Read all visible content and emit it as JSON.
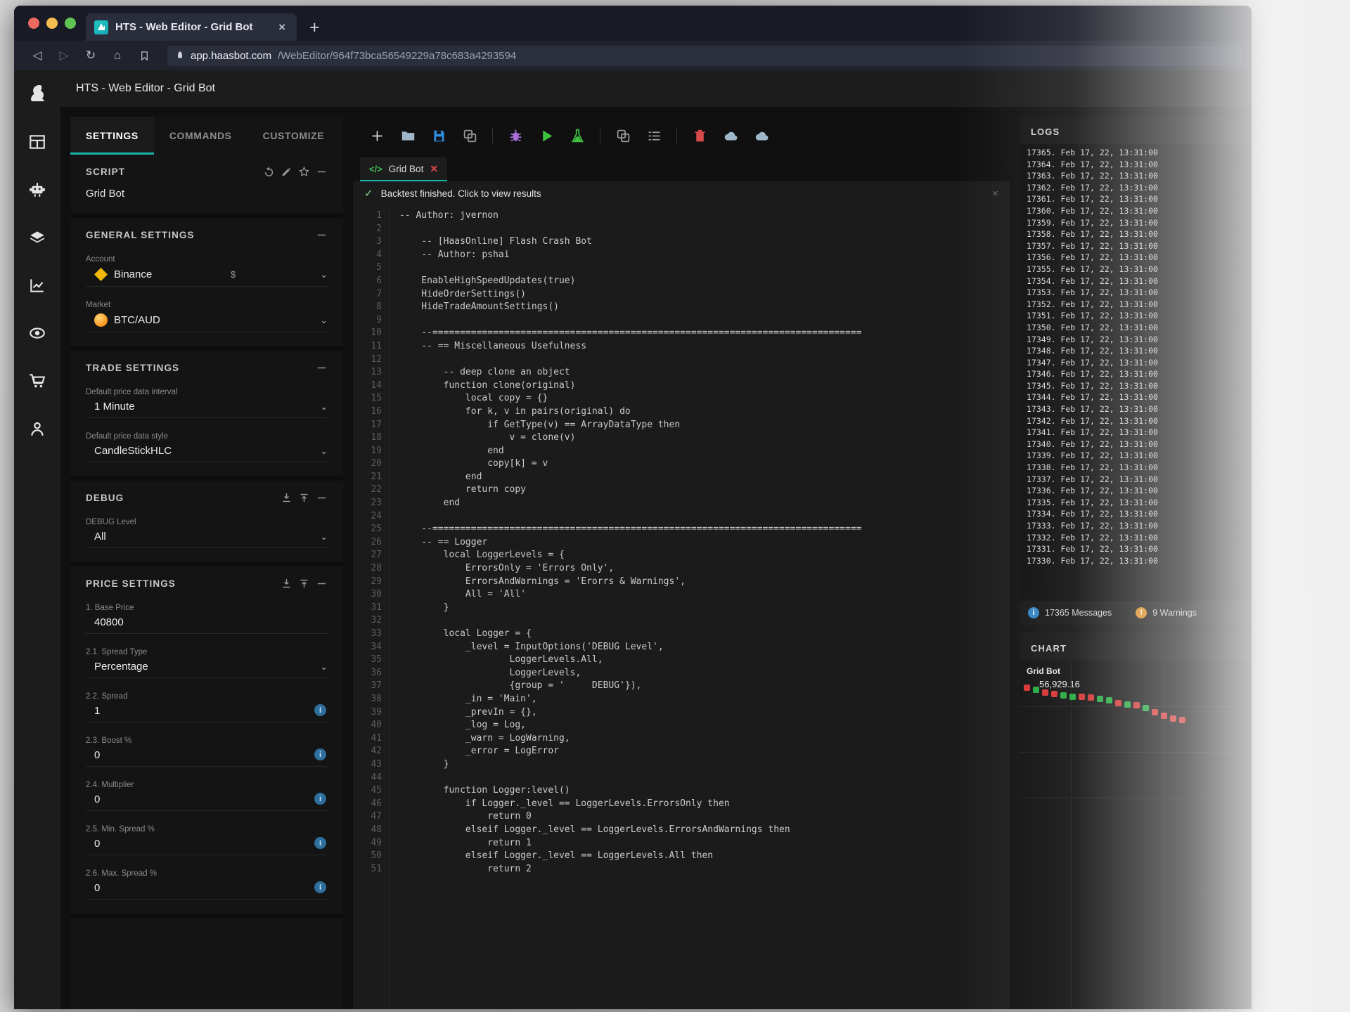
{
  "browser": {
    "tab_title": "HTS - Web Editor - Grid Bot",
    "tab_close": "×",
    "new_tab": "+",
    "favicon_glyph": "◤",
    "back": "◁",
    "forward": "▷",
    "reload": "↻",
    "home": "⌂",
    "bookmark": "☐",
    "lock": "🔒",
    "url_host": "app.haasbot.com",
    "url_path": "/WebEditor/964f73bca56549229a78c683a4293594"
  },
  "app": {
    "title": "HTS - Web Editor - Grid Bot",
    "accent": "#16b6a8",
    "rail": [
      {
        "name": "logo-rabbit"
      },
      {
        "name": "dashboard-grid"
      },
      {
        "name": "bot"
      },
      {
        "name": "layers"
      },
      {
        "name": "chart"
      },
      {
        "name": "coin"
      },
      {
        "name": "cart"
      },
      {
        "name": "account"
      }
    ]
  },
  "settings_panel": {
    "tabs": [
      {
        "label": "SETTINGS",
        "active": true
      },
      {
        "label": "COMMANDS",
        "active": false
      },
      {
        "label": "CUSTOMIZE",
        "active": false
      }
    ],
    "script": {
      "heading": "SCRIPT",
      "name": "Grid Bot",
      "actions": [
        "revert-icon",
        "edit-icon",
        "star-icon",
        "collapse-icon"
      ]
    },
    "general": {
      "heading": "GENERAL SETTINGS",
      "fields": [
        {
          "label": "Account",
          "value": "Binance",
          "icon": "bnb",
          "suffix": "$",
          "caret": true
        },
        {
          "label": "Market",
          "value": "BTC/AUD",
          "icon": "btc",
          "suffix": "",
          "caret": true
        }
      ]
    },
    "trade": {
      "heading": "TRADE SETTINGS",
      "fields": [
        {
          "label": "Default price data interval",
          "value": "1 Minute",
          "caret": true
        },
        {
          "label": "Default price data style",
          "value": "CandleStickHLC",
          "caret": true
        }
      ]
    },
    "debug": {
      "heading": "DEBUG",
      "fields": [
        {
          "label": "DEBUG Level",
          "value": "All",
          "caret": true
        }
      ]
    },
    "price": {
      "heading": "PRICE SETTINGS",
      "fields": [
        {
          "label": "1. Base Price",
          "value": "40800",
          "info": false
        },
        {
          "label": "2.1. Spread Type",
          "value": "Percentage",
          "caret": true
        },
        {
          "label": "2.2. Spread",
          "value": "1",
          "info": true
        },
        {
          "label": "2.3. Boost %",
          "value": "0",
          "info": true
        },
        {
          "label": "2.4. Multiplier",
          "value": "0",
          "info": true
        },
        {
          "label": "2.5. Min. Spread %",
          "value": "0",
          "info": true
        },
        {
          "label": "2.6. Max. Spread %",
          "value": "0",
          "info": true
        }
      ]
    }
  },
  "editor": {
    "toolbar": [
      {
        "name": "new-icon",
        "glyph": "plus",
        "color": "#d6d6d6"
      },
      {
        "name": "open-folder-icon",
        "glyph": "folder",
        "color": "#9fb8c9"
      },
      {
        "name": "save-icon",
        "glyph": "save",
        "color": "#2f8fe0"
      },
      {
        "name": "clone-icon",
        "glyph": "copy",
        "color": "#9a9a9a"
      },
      {
        "name": "sep1",
        "glyph": "sep",
        "color": ""
      },
      {
        "name": "debug-icon",
        "glyph": "bug",
        "color": "#a96fd6"
      },
      {
        "name": "run-icon",
        "glyph": "play",
        "color": "#3fbf42"
      },
      {
        "name": "backtest-icon",
        "glyph": "flask",
        "color": "#3fbf42"
      },
      {
        "name": "sep2",
        "glyph": "sep",
        "color": ""
      },
      {
        "name": "duplicate-icon",
        "glyph": "copy",
        "color": "#9a9a9a"
      },
      {
        "name": "list-icon",
        "glyph": "list",
        "color": "#9a9a9a"
      },
      {
        "name": "sep3",
        "glyph": "sep",
        "color": ""
      },
      {
        "name": "delete-icon",
        "glyph": "trash",
        "color": "#d94b4b"
      },
      {
        "name": "cloud-download-icon",
        "glyph": "cloud",
        "color": "#9fb8c9"
      },
      {
        "name": "cloud-upload-icon",
        "glyph": "cloud",
        "color": "#9fb8c9"
      }
    ],
    "tab": {
      "label": "Grid Bot",
      "code_glyph": "</>",
      "close": "✕"
    },
    "status": {
      "icon": "✓",
      "text": "Backtest finished. Click to view results",
      "close": "×"
    },
    "code": [
      {
        "n": 1,
        "t": "-- Author: jvernon",
        "c": "cmt"
      },
      {
        "n": 2,
        "t": "",
        "c": ""
      },
      {
        "n": 3,
        "t": "    -- [HaasOnline] Flash Crash Bot",
        "c": "cmt"
      },
      {
        "n": 4,
        "t": "    -- Author: pshai",
        "c": "cmt"
      },
      {
        "n": 5,
        "t": "",
        "c": ""
      },
      {
        "n": 6,
        "t": "    EnableHighSpeedUpdates(true)",
        "c": "fn"
      },
      {
        "n": 7,
        "t": "    HideOrderSettings()",
        "c": "fn"
      },
      {
        "n": 8,
        "t": "    HideTradeAmountSettings()",
        "c": "fn"
      },
      {
        "n": 9,
        "t": "",
        "c": ""
      },
      {
        "n": 10,
        "t": "    --==============================================================================",
        "c": "cmt"
      },
      {
        "n": 11,
        "t": "    -- == Miscellaneous Usefulness",
        "c": "cmt"
      },
      {
        "n": 12,
        "t": "",
        "c": ""
      },
      {
        "n": 13,
        "t": "        -- deep clone an object",
        "c": "cmt"
      },
      {
        "n": 14,
        "t": "        function clone(original)",
        "c": "kw"
      },
      {
        "n": 15,
        "t": "            local copy = {}",
        "c": "kw"
      },
      {
        "n": 16,
        "t": "            for k, v in pairs(original) do",
        "c": "kw"
      },
      {
        "n": 17,
        "t": "                if GetType(v) == ArrayDataType then",
        "c": "kw"
      },
      {
        "n": 18,
        "t": "                    v = clone(v)",
        "c": "idf"
      },
      {
        "n": 19,
        "t": "                end",
        "c": "kw"
      },
      {
        "n": 20,
        "t": "                copy[k] = v",
        "c": "idf"
      },
      {
        "n": 21,
        "t": "            end",
        "c": "kw"
      },
      {
        "n": 22,
        "t": "            return copy",
        "c": "kw"
      },
      {
        "n": 23,
        "t": "        end",
        "c": "kw"
      },
      {
        "n": 24,
        "t": "",
        "c": ""
      },
      {
        "n": 25,
        "t": "    --==============================================================================",
        "c": "cmt"
      },
      {
        "n": 26,
        "t": "    -- == Logger",
        "c": "cmt"
      },
      {
        "n": 27,
        "t": "        local LoggerLevels = {",
        "c": "kw"
      },
      {
        "n": 28,
        "t": "            ErrorsOnly = 'Errors Only',",
        "c": "str"
      },
      {
        "n": 29,
        "t": "            ErrorsAndWarnings = 'Erorrs & Warnings',",
        "c": "str"
      },
      {
        "n": 30,
        "t": "            All = 'All'",
        "c": "str"
      },
      {
        "n": 31,
        "t": "        }",
        "c": "idf"
      },
      {
        "n": 32,
        "t": "",
        "c": ""
      },
      {
        "n": 33,
        "t": "        local Logger = {",
        "c": "kw"
      },
      {
        "n": 34,
        "t": "            _level = InputOptions('DEBUG Level',",
        "c": "fn"
      },
      {
        "n": 35,
        "t": "                    LoggerLevels.All,",
        "c": "idf"
      },
      {
        "n": 36,
        "t": "                    LoggerLevels,",
        "c": "idf"
      },
      {
        "n": 37,
        "t": "                    {group = '     DEBUG'}),",
        "c": "str"
      },
      {
        "n": 38,
        "t": "            _in = 'Main',",
        "c": "str"
      },
      {
        "n": 39,
        "t": "            _prevIn = {},",
        "c": "idf"
      },
      {
        "n": 40,
        "t": "            _log = Log,",
        "c": "fn"
      },
      {
        "n": 41,
        "t": "            _warn = LogWarning,",
        "c": "fn"
      },
      {
        "n": 42,
        "t": "            _error = LogError",
        "c": "fn"
      },
      {
        "n": 43,
        "t": "        }",
        "c": "idf"
      },
      {
        "n": 44,
        "t": "",
        "c": ""
      },
      {
        "n": 45,
        "t": "        function Logger:level()",
        "c": "kw"
      },
      {
        "n": 46,
        "t": "            if Logger._level == LoggerLevels.ErrorsOnly then",
        "c": "kw"
      },
      {
        "n": 47,
        "t": "                return 0",
        "c": "kw"
      },
      {
        "n": 48,
        "t": "            elseif Logger._level == LoggerLevels.ErrorsAndWarnings then",
        "c": "kw"
      },
      {
        "n": 49,
        "t": "                return 1",
        "c": "kw"
      },
      {
        "n": 50,
        "t": "            elseif Logger._level == LoggerLevels.All then",
        "c": "kw"
      },
      {
        "n": 51,
        "t": "                return 2",
        "c": "kw"
      }
    ]
  },
  "logs_panel": {
    "heading": "LOGS",
    "entries": [
      "17365. Feb 17, 22, 13:31:00",
      "17364. Feb 17, 22, 13:31:00",
      "17363. Feb 17, 22, 13:31:00",
      "17362. Feb 17, 22, 13:31:00",
      "17361. Feb 17, 22, 13:31:00",
      "17360. Feb 17, 22, 13:31:00",
      "17359. Feb 17, 22, 13:31:00",
      "17358. Feb 17, 22, 13:31:00",
      "17357. Feb 17, 22, 13:31:00",
      "17356. Feb 17, 22, 13:31:00",
      "17355. Feb 17, 22, 13:31:00",
      "17354. Feb 17, 22, 13:31:00",
      "17353. Feb 17, 22, 13:31:00",
      "17352. Feb 17, 22, 13:31:00",
      "17351. Feb 17, 22, 13:31:00",
      "17350. Feb 17, 22, 13:31:00",
      "17349. Feb 17, 22, 13:31:00",
      "17348. Feb 17, 22, 13:31:00",
      "17347. Feb 17, 22, 13:31:00",
      "17346. Feb 17, 22, 13:31:00",
      "17345. Feb 17, 22, 13:31:00",
      "17344. Feb 17, 22, 13:31:00",
      "17343. Feb 17, 22, 13:31:00",
      "17342. Feb 17, 22, 13:31:00",
      "17341. Feb 17, 22, 13:31:00",
      "17340. Feb 17, 22, 13:31:00",
      "17339. Feb 17, 22, 13:31:00",
      "17338. Feb 17, 22, 13:31:00",
      "17337. Feb 17, 22, 13:31:00",
      "17336. Feb 17, 22, 13:31:00",
      "17335. Feb 17, 22, 13:31:00",
      "17334. Feb 17, 22, 13:31:00",
      "17333. Feb 17, 22, 13:31:00",
      "17332. Feb 17, 22, 13:31:00",
      "17331. Feb 17, 22, 13:31:00",
      "17330. Feb 17, 22, 13:31:00"
    ],
    "messages_count": "17365 Messages",
    "warnings_count": "9 Warnings",
    "info_glyph": "i",
    "warn_glyph": "!"
  },
  "chart_panel": {
    "heading": "CHART",
    "series_label": "Grid Bot",
    "price": "56,929.16"
  },
  "chart_data": {
    "type": "line",
    "title": "Grid Bot",
    "xlabel": "",
    "ylabel": "",
    "annotations": [
      "56,929.16"
    ],
    "x": [
      0,
      1,
      2,
      3,
      4,
      5,
      6,
      7,
      8,
      9,
      10,
      11,
      12,
      13,
      14,
      15,
      16,
      17
    ],
    "values": [
      74,
      72,
      70,
      69,
      68,
      67,
      67,
      66,
      65,
      64,
      62,
      61,
      60,
      58,
      55,
      52,
      50,
      49
    ],
    "point_colors": [
      "red",
      "green",
      "red",
      "red",
      "green",
      "green",
      "red",
      "red",
      "green",
      "green",
      "red",
      "green",
      "red",
      "green",
      "red",
      "red",
      "red",
      "red"
    ]
  }
}
